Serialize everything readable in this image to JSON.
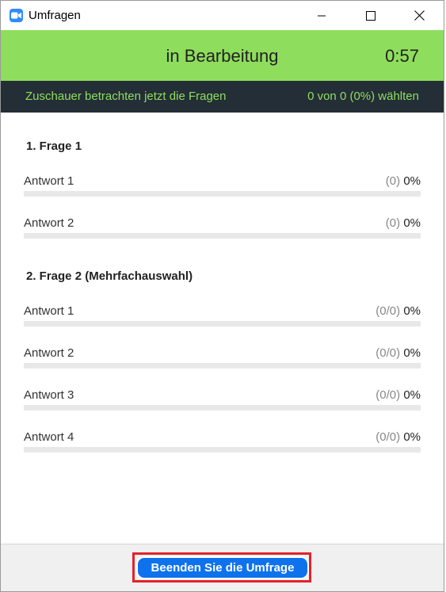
{
  "window": {
    "title": "Umfragen"
  },
  "status": {
    "text": "in Bearbeitung",
    "timer": "0:57"
  },
  "info": {
    "left": "Zuschauer betrachten jetzt die Fragen",
    "right": "0 von 0 (0%) wählten"
  },
  "questions": [
    {
      "title": "1. Frage 1",
      "answers": [
        {
          "label": "Antwort 1",
          "count": "(0)",
          "percent": "0%",
          "fill": 0
        },
        {
          "label": "Antwort 2",
          "count": "(0)",
          "percent": "0%",
          "fill": 0
        }
      ]
    },
    {
      "title": "2. Frage 2 (Mehrfachauswahl)",
      "answers": [
        {
          "label": "Antwort 1",
          "count": "(0/0)",
          "percent": "0%",
          "fill": 0
        },
        {
          "label": "Antwort 2",
          "count": "(0/0)",
          "percent": "0%",
          "fill": 0
        },
        {
          "label": "Antwort 3",
          "count": "(0/0)",
          "percent": "0%",
          "fill": 0
        },
        {
          "label": "Antwort 4",
          "count": "(0/0)",
          "percent": "0%",
          "fill": 0
        }
      ]
    }
  ],
  "footer": {
    "end_button": "Beenden Sie die Umfrage"
  },
  "colors": {
    "status_green": "#8fdd5d",
    "info_dark": "#232e36",
    "button_blue": "#0e72ed",
    "highlight_red": "#e5212b"
  },
  "icons": {
    "app": "zoom-camera-icon",
    "minimize": "minimize-icon",
    "maximize": "maximize-icon",
    "close": "close-icon"
  }
}
